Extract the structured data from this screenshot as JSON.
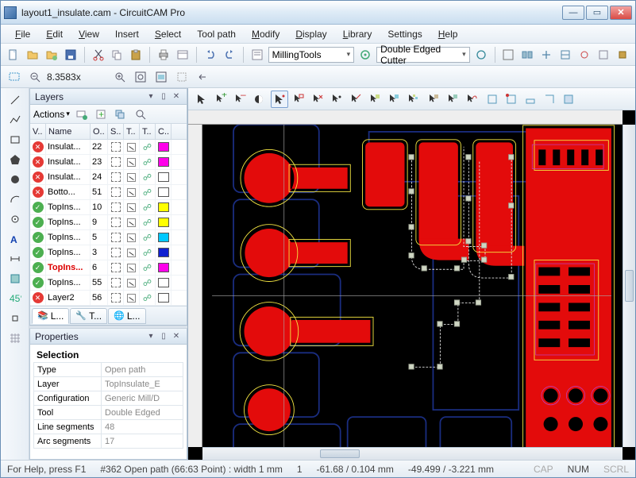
{
  "window": {
    "title": "layout1_insulate.cam - CircuitCAM Pro"
  },
  "menu": [
    "File",
    "Edit",
    "View",
    "Insert",
    "Select",
    "Tool path",
    "Modify",
    "Display",
    "Library",
    "Settings",
    "Help"
  ],
  "menu_underline": [
    0,
    0,
    0,
    null,
    0,
    null,
    0,
    0,
    0,
    null,
    0
  ],
  "toolbar1": {
    "combo1": "MillingTools",
    "combo2": "Double Edged Cutter"
  },
  "toolbar2": {
    "zoom": "8.3583x"
  },
  "layers_panel": {
    "title": "Layers",
    "actions_label": "Actions",
    "columns": [
      "V..",
      "Name",
      "O..",
      "S..",
      "T..",
      "T..",
      "C.."
    ],
    "rows": [
      {
        "vis": false,
        "name": "Insulat...",
        "o": "22",
        "color": "#ff00ea",
        "active": false
      },
      {
        "vis": false,
        "name": "Insulat...",
        "o": "23",
        "color": "#ff00ea",
        "active": false
      },
      {
        "vis": false,
        "name": "Insulat...",
        "o": "24",
        "color": "#ffffff",
        "active": false
      },
      {
        "vis": false,
        "name": "Botto...",
        "o": "51",
        "color": "#ffffff",
        "active": false
      },
      {
        "vis": true,
        "name": "TopIns...",
        "o": "10",
        "color": "#ffff00",
        "active": false
      },
      {
        "vis": true,
        "name": "TopIns...",
        "o": "9",
        "color": "#ffff00",
        "active": false
      },
      {
        "vis": true,
        "name": "TopIns...",
        "o": "5",
        "color": "#00c8ff",
        "active": false
      },
      {
        "vis": true,
        "name": "TopIns...",
        "o": "3",
        "color": "#1020d0",
        "active": false
      },
      {
        "vis": true,
        "name": "TopIns...",
        "o": "6",
        "color": "#ff00ea",
        "active": true
      },
      {
        "vis": true,
        "name": "TopIns...",
        "o": "55",
        "color": "#ffffff",
        "active": false
      },
      {
        "vis": false,
        "name": "Layer2",
        "o": "56",
        "color": "#ffffff",
        "active": false
      }
    ],
    "tabs": [
      "L...",
      "T...",
      "L..."
    ]
  },
  "properties_panel": {
    "title": "Properties",
    "section": "Selection",
    "rows": [
      [
        "Type",
        "Open path"
      ],
      [
        "Layer",
        "TopInsulate_E"
      ],
      [
        "Configuration",
        "Generic Mill/D"
      ],
      [
        "Tool",
        "Double Edged"
      ],
      [
        "Line segments",
        "48"
      ],
      [
        "Arc segments",
        "17"
      ]
    ]
  },
  "status": {
    "help": "For Help, press F1",
    "object": "#362 Open path (66:63 Point) : width 1 mm",
    "num": "1",
    "coord1": "-61.68 / 0.104 mm",
    "coord2": "-49.499 / -3.221 mm",
    "caps": "CAP",
    "numlock": "NUM",
    "scroll": "SCRL"
  }
}
